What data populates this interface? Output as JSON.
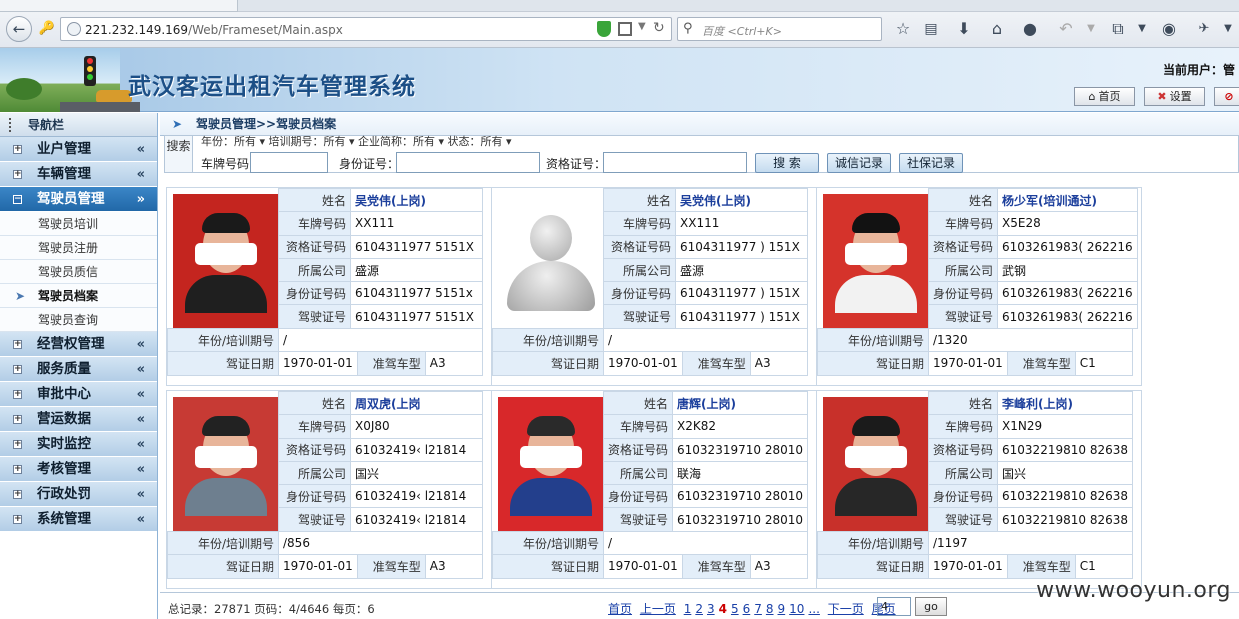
{
  "browser": {
    "url_host": "221.232.149.169",
    "url_path": "/Web/Frameset/Main.aspx",
    "search_placeholder": "百度 <Ctrl+K>"
  },
  "header": {
    "system_title": "武汉客运出租汽车管理系统",
    "current_user": "当前用户：管",
    "buttons": [
      {
        "label": "首页",
        "icon": "home-icon"
      },
      {
        "label": "设置",
        "icon": "tools-icon"
      },
      {
        "label": "",
        "icon": "stop-icon"
      }
    ]
  },
  "sidebar": {
    "title": "导航栏",
    "menus": [
      {
        "label": "业户管理"
      },
      {
        "label": "车辆管理"
      },
      {
        "label": "驾驶员管理",
        "active": true
      },
      {
        "label": "经营权管理"
      },
      {
        "label": "服务质量"
      },
      {
        "label": "审批中心"
      },
      {
        "label": "营运数据"
      },
      {
        "label": "实时监控"
      },
      {
        "label": "考核管理"
      },
      {
        "label": "行政处罚"
      },
      {
        "label": "系统管理"
      }
    ],
    "submenu": [
      {
        "label": "驾驶员培训"
      },
      {
        "label": "驾驶员注册"
      },
      {
        "label": "驾驶员质信"
      },
      {
        "label": "驾驶员档案",
        "current": true
      },
      {
        "label": "驾驶员查询"
      }
    ]
  },
  "breadcrumb": "驾驶员管理>>驾驶员档案",
  "search": {
    "section_label": "搜索",
    "cut_row": "年份：所有 ▾   培训期号：所有 ▾   企业简称：所有 ▾   状态：所有 ▾",
    "plate_label": "车牌号码",
    "id_label": "身份证号：",
    "cert_label": "资格证号：",
    "search_button": "搜 索",
    "credit_button": "诚信记录",
    "social_button": "社保记录"
  },
  "field_labels": {
    "name": "姓名",
    "plate": "车牌号码",
    "cert": "资格证号码",
    "company": "所属公司",
    "id": "身份证号码",
    "license": "驾驶证号",
    "year": "年份/培训期号",
    "date": "驾证日期",
    "vehicle_type": "准驾车型"
  },
  "drivers": [
    {
      "name": "吴党伟(上岗)",
      "plate": "XX111",
      "cert": "6104311977      5151X",
      "company": "盛源",
      "id": "6104311977      5151x",
      "license": "6104311977      5151X",
      "year": "/",
      "date": "1970-01-01",
      "vtype": "A3",
      "photo": "face",
      "bg": "#c4251f",
      "hair": "#1a1a1a",
      "shirt": "#1f1f1f"
    },
    {
      "name": "吴党伟(上岗)",
      "plate": "XX111",
      "cert": "6104311977   )   151X",
      "company": "盛源",
      "id": "6104311977   )   151X",
      "license": "6104311977   )   151X",
      "year": "/",
      "date": "1970-01-01",
      "vtype": "A3",
      "photo": "avatar"
    },
    {
      "name": "杨少军(培训通过)",
      "plate": "X5E28",
      "cert": "6103261983(    262216",
      "company": "武钢",
      "id": "6103261983(    262216",
      "license": "6103261983(    262216",
      "year": "/1320",
      "date": "1970-01-01",
      "vtype": "C1",
      "photo": "face",
      "bg": "#d5332b",
      "hair": "#121212",
      "shirt": "#f2f2f2"
    },
    {
      "name": "周双虎(上岗",
      "plate": "X0J80",
      "cert": "61032419‹     l21814",
      "company": "国兴",
      "id": "61032419‹     l21814",
      "license": "61032419‹     l21814",
      "year": "/856",
      "date": "1970-01-01",
      "vtype": "A3",
      "photo": "face",
      "bg": "#c73a34",
      "hair": "#222",
      "shirt": "#6e7f8f"
    },
    {
      "name": "唐辉(上岗)",
      "plate": "X2K82",
      "cert": "61032319710      28010",
      "company": "联海",
      "id": "61032319710      28010",
      "license": "61032319710      28010",
      "year": "/",
      "date": "1970-01-01",
      "vtype": "A3",
      "photo": "face",
      "bg": "#d8282a",
      "hair": "#2a2a2a",
      "shirt": "#233f8c"
    },
    {
      "name": "李峰利(上岗)",
      "plate": "X1N29",
      "cert": "61032219810      82638",
      "company": "国兴",
      "id": "61032219810      82638",
      "license": "61032219810      82638",
      "year": "/1197",
      "date": "1970-01-01",
      "vtype": "C1",
      "photo": "face",
      "bg": "#c8302a",
      "hair": "#1b1b1b",
      "shirt": "#272727"
    }
  ],
  "pager": {
    "summary": "总记录：27871 页码：4/4646 每页：6",
    "first": "首页",
    "prev": "上一页",
    "pages": [
      "1",
      "2",
      "3",
      "4",
      "5",
      "6",
      "7",
      "8",
      "9",
      "10",
      "..."
    ],
    "current": "4",
    "next": "下一页",
    "last": "尾页",
    "input_value": "4",
    "go": "go"
  },
  "watermark": "www.wooyun.org"
}
